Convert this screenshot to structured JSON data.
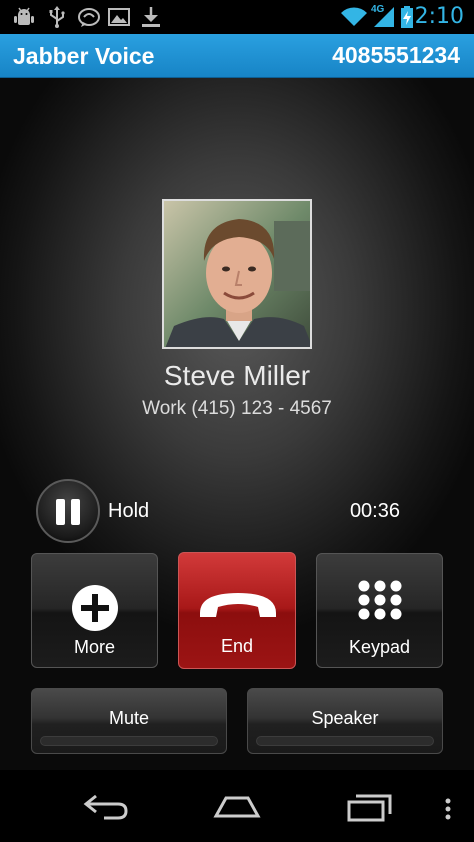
{
  "status_bar": {
    "time": "2:10",
    "network": "4G",
    "icons": [
      "android-debug-icon",
      "usb-icon",
      "voicemail-icon",
      "image-icon",
      "download-icon",
      "wifi-icon",
      "signal-icon",
      "battery-charging-icon"
    ]
  },
  "header": {
    "title": "Jabber Voice",
    "my_number": "4085551234"
  },
  "call": {
    "contact_name": "Steve Miller",
    "contact_number": "Work (415) 123 - 4567",
    "hold_label": "Hold",
    "elapsed": "00:36"
  },
  "actions": {
    "more_label": "More",
    "end_label": "End",
    "keypad_label": "Keypad",
    "mute_label": "Mute",
    "speaker_label": "Speaker"
  },
  "colors": {
    "accent": "#33b5e5",
    "title_bar": "#1d8fd1",
    "end_call": "#a81818"
  }
}
